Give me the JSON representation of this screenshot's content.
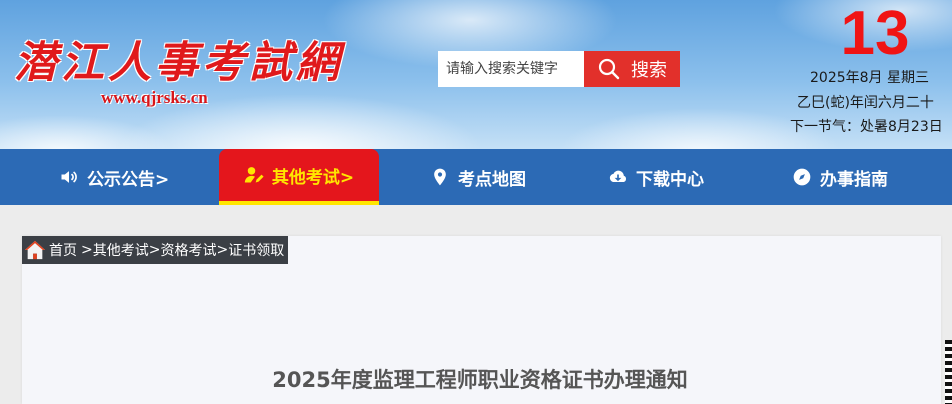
{
  "header": {
    "site_title": "潜江人事考試網",
    "site_url": "www.qjrsks.cn",
    "search": {
      "placeholder": "请输入搜索关键字",
      "button_label": "搜索"
    },
    "date": {
      "day": "13",
      "month_weekday": "2025年8月 星期三",
      "lunar": "乙巳(蛇)年闰六月二十",
      "solar_term": "下一节气：处暑8月23日"
    }
  },
  "nav": {
    "items": [
      {
        "label": "公示公告>",
        "icon": "speaker-icon"
      },
      {
        "label": "其他考试>",
        "icon": "user-edit-icon",
        "active": true
      },
      {
        "label": "考点地图",
        "icon": "map-pin-icon"
      },
      {
        "label": "下载中心",
        "icon": "cloud-download-icon"
      },
      {
        "label": "办事指南",
        "icon": "compass-icon"
      }
    ]
  },
  "breadcrumb": {
    "home": "首页",
    "sep": ">",
    "items": [
      "其他考试",
      "资格考试",
      "证书领取"
    ]
  },
  "article": {
    "title": "2025年度监理工程师职业资格证书办理通知"
  },
  "colors": {
    "nav_bg": "#2c6ab5",
    "active_bg": "#e4161c",
    "active_text": "#ffe600",
    "search_btn": "#e2302b",
    "date_day": "#f01414"
  }
}
